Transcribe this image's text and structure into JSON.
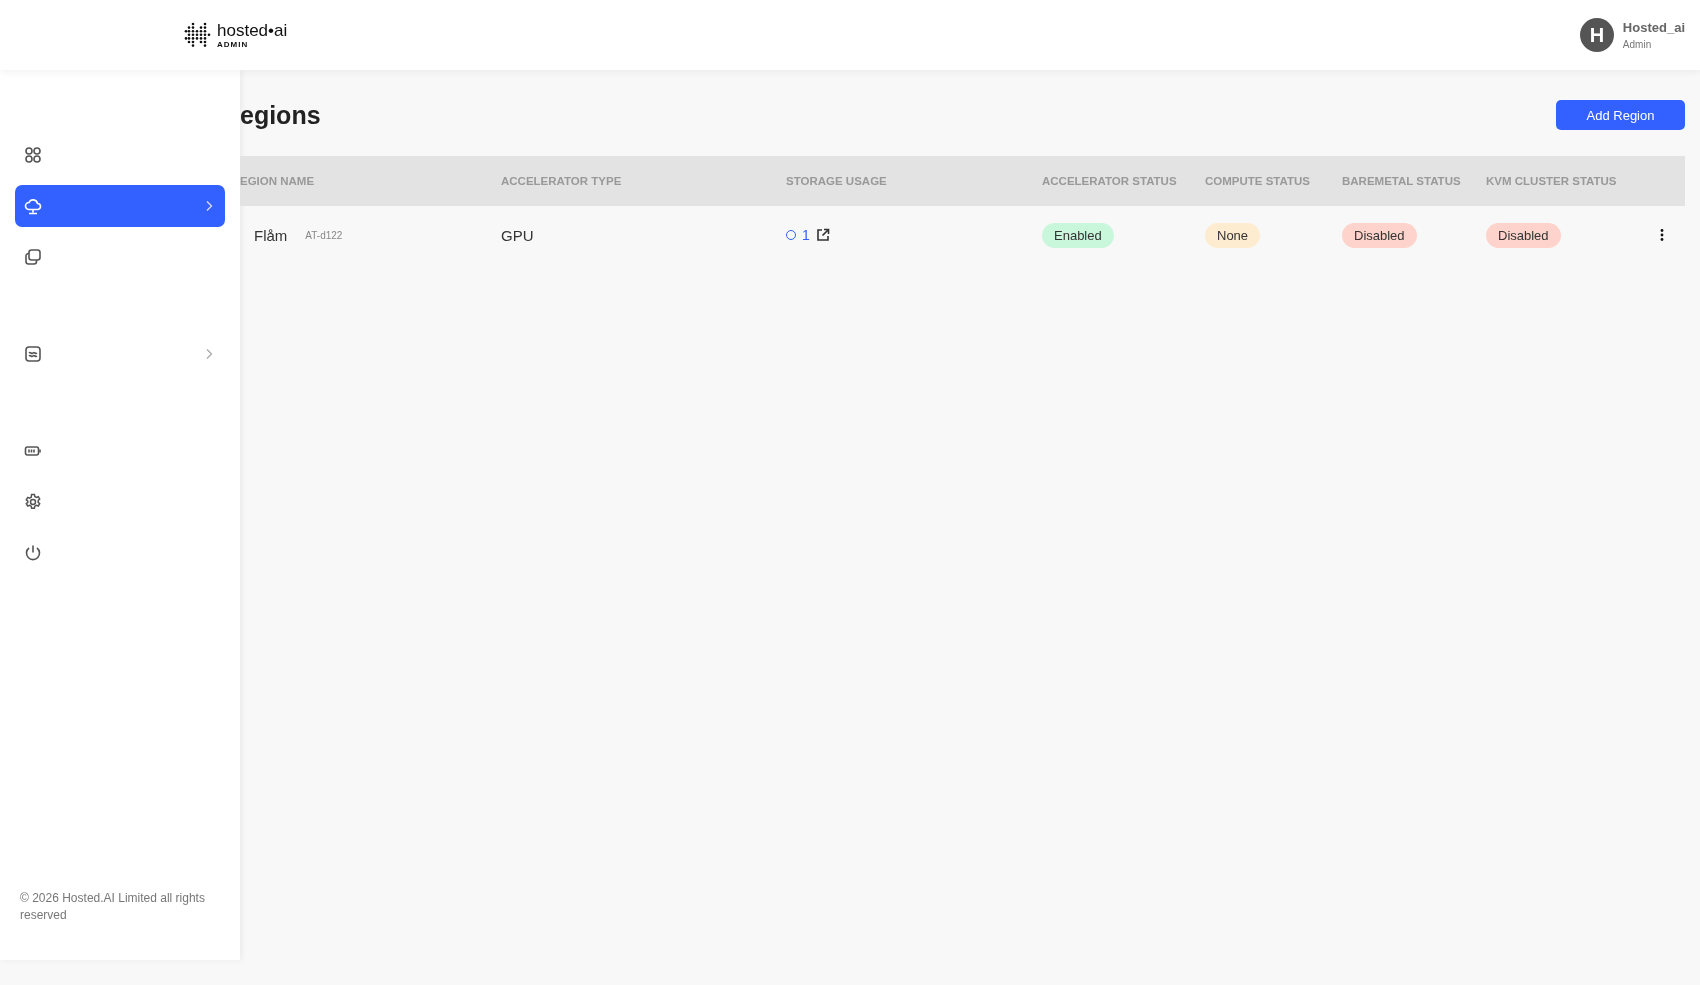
{
  "header": {
    "logo": {
      "name": "hosted•ai",
      "sub": "ADMIN"
    },
    "user": {
      "initial": "H",
      "name": "Hosted_ai",
      "role": "Admin"
    }
  },
  "sidebar": {
    "items": [
      {
        "kind": "grid",
        "selected": false,
        "expandable": false
      },
      {
        "kind": "cloud",
        "selected": true,
        "expandable": true
      },
      {
        "kind": "copy",
        "selected": false,
        "expandable": false
      },
      {
        "kind": "wave",
        "selected": false,
        "expandable": true
      },
      {
        "kind": "battery",
        "selected": false,
        "expandable": false
      },
      {
        "kind": "gear",
        "selected": false,
        "expandable": false
      },
      {
        "kind": "power",
        "selected": false,
        "expandable": false
      }
    ],
    "footer": "© 2026 Hosted.AI Limited all rights reserved"
  },
  "page": {
    "title": "egions",
    "add_button": "Add Region"
  },
  "table": {
    "columns": [
      "EGION NAME",
      "ACCELERATOR TYPE",
      "STORAGE USAGE",
      "ACCELERATOR STATUS",
      "COMPUTE STATUS",
      "BAREMETAL STATUS",
      "KVM CLUSTER STATUS"
    ],
    "rows": [
      {
        "name": "Flåm",
        "code": "AT-d122",
        "accelerator_type": "GPU",
        "storage": "1",
        "statuses": [
          {
            "label": "Enabled",
            "color": "#c8f7dc"
          },
          {
            "label": "None",
            "color": "#feecd0"
          },
          {
            "label": "Disabled",
            "color": "#fdd3cc"
          },
          {
            "label": "Disabled",
            "color": "#fdd3cc"
          }
        ]
      }
    ]
  }
}
